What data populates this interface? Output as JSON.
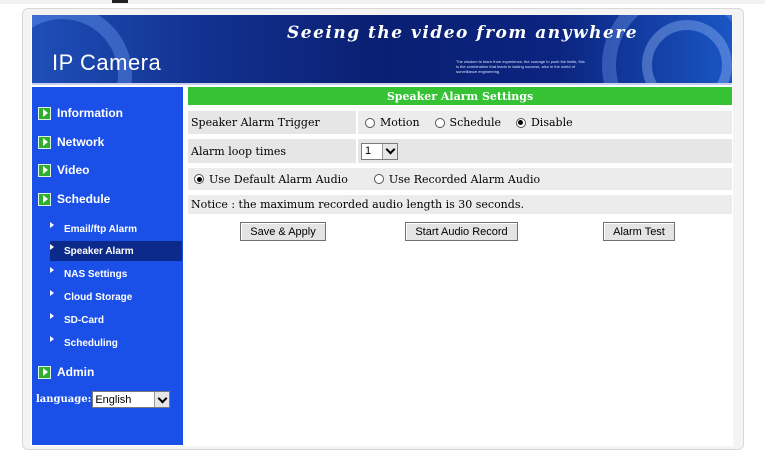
{
  "header": {
    "logo_text": "IP Camera",
    "tagline": "Seeing the video from anywhere",
    "small_text": "The wisdom to learn from experience, the courage to push the limits, this is the combination that leads to lasting success, also in the world of surveillance engineering."
  },
  "sidebar": {
    "main_items": [
      {
        "label": "Information"
      },
      {
        "label": "Network"
      },
      {
        "label": "Video"
      },
      {
        "label": "Schedule"
      }
    ],
    "sub_items": [
      {
        "label": "Email/ftp Alarm"
      },
      {
        "label": "Speaker Alarm"
      },
      {
        "label": "NAS Settings"
      },
      {
        "label": "Cloud Storage"
      },
      {
        "label": "SD-Card"
      },
      {
        "label": "Scheduling"
      }
    ],
    "admin_label": "Admin",
    "language_label": "language:",
    "language_value": "English"
  },
  "main": {
    "title": "Speaker Alarm Settings",
    "trigger": {
      "label": "Speaker Alarm Trigger",
      "options": [
        "Motion",
        "Schedule",
        "Disable"
      ],
      "selected": "Disable"
    },
    "loop": {
      "label": "Alarm loop times",
      "value": "1"
    },
    "audio": {
      "options": [
        "Use Default Alarm Audio",
        "Use Recorded Alarm Audio"
      ],
      "selected": "Use Default Alarm Audio"
    },
    "notice": "Notice : the maximum recorded audio length is 30 seconds.",
    "buttons": {
      "save": "Save & Apply",
      "record": "Start Audio Record",
      "test": "Alarm Test"
    }
  },
  "colors": {
    "sidebar_bg": "#1a4fe8",
    "title_bar": "#35c235",
    "active_sub": "#0b2a8a"
  }
}
